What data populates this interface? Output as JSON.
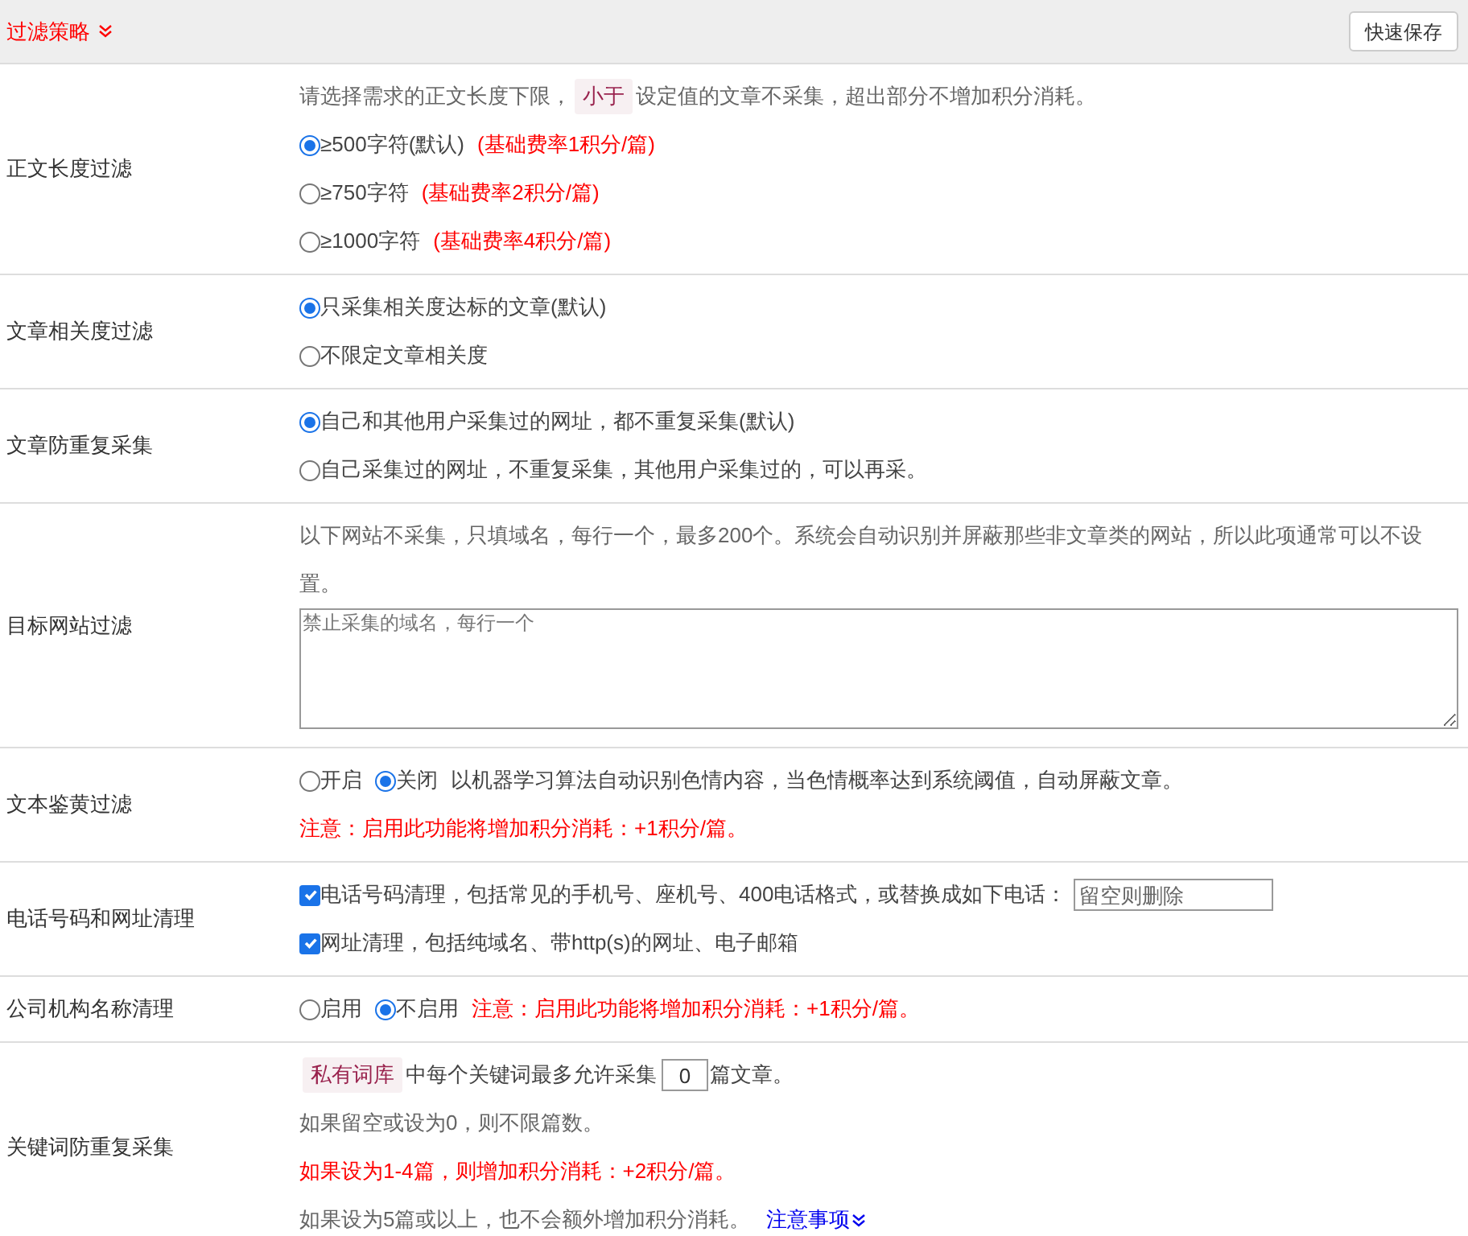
{
  "header": {
    "title": "过滤策略",
    "button": "快速保存"
  },
  "rows": [
    {
      "label": "正文长度过滤",
      "lines": [
        [
          {
            "kind": "text",
            "text": "请选择需求的正文长度下限，"
          },
          {
            "kind": "tag",
            "text": "小于"
          },
          {
            "kind": "text",
            "text": "设定值的文章不采集，超出部分不增加积分消耗。"
          }
        ],
        [
          {
            "kind": "radio",
            "text": "≥500字符(默认)",
            "selected": true
          },
          {
            "kind": "note",
            "text": "(基础费率1积分/篇)"
          }
        ],
        [
          {
            "kind": "radio",
            "text": "≥750字符",
            "selected": false
          },
          {
            "kind": "note",
            "text": "(基础费率2积分/篇)"
          }
        ],
        [
          {
            "kind": "radio",
            "text": "≥1000字符",
            "selected": false
          },
          {
            "kind": "note",
            "text": "(基础费率4积分/篇)"
          }
        ]
      ]
    },
    {
      "label": "文章相关度过滤",
      "lines": [
        [
          {
            "kind": "radio",
            "text": "只采集相关度达标的文章(默认)",
            "selected": true
          }
        ],
        [
          {
            "kind": "radio",
            "text": "不限定文章相关度",
            "selected": false
          }
        ]
      ]
    },
    {
      "label": "文章防重复采集",
      "lines": [
        [
          {
            "kind": "radio",
            "text": "自己和其他用户采集过的网址，都不重复采集(默认)",
            "selected": true
          }
        ],
        [
          {
            "kind": "radio",
            "text": "自己采集过的网址，不重复采集，其他用户采集过的，可以再采。",
            "selected": false
          }
        ]
      ]
    },
    {
      "label": "目标网站过滤",
      "lines": [
        [
          {
            "kind": "text",
            "text": "以下网站不采集，只填域名，每行一个，最多200个。系统会自动识别并屏蔽那些非文章类的网站，所以此项通常可以不设置。"
          }
        ],
        [
          {
            "kind": "textarea",
            "placeholder": "禁止采集的域名，每行一个"
          }
        ]
      ]
    },
    {
      "label": "文本鉴黄过滤",
      "lines": [
        [
          {
            "kind": "radio",
            "text": "开启",
            "selected": false
          },
          {
            "kind": "radio",
            "text": "关闭",
            "selected": true
          },
          {
            "kind": "body",
            "text": "以机器学习算法自动识别色情内容，当色情概率达到系统阈值，自动屏蔽文章。"
          }
        ],
        [
          {
            "kind": "note",
            "text": "注意：启用此功能将增加积分消耗：+1积分/篇。"
          }
        ]
      ]
    },
    {
      "label": "电话号码和网址清理",
      "lines": [
        [
          {
            "kind": "checkbox",
            "text": "电话号码清理，包括常见的手机号、座机号、400电话格式，或替换成如下电话：",
            "checked": true
          },
          {
            "kind": "input",
            "placeholder": "留空则删除"
          }
        ],
        [
          {
            "kind": "checkbox",
            "text": "网址清理，包括纯域名、带http(s)的网址、电子邮箱",
            "checked": true
          }
        ]
      ]
    },
    {
      "label": "公司机构名称清理",
      "lines": [
        [
          {
            "kind": "radio",
            "text": "启用",
            "selected": false
          },
          {
            "kind": "radio",
            "text": "不启用",
            "selected": true
          },
          {
            "kind": "note",
            "text": "注意：启用此功能将增加积分消耗：+1积分/篇。"
          }
        ]
      ]
    },
    {
      "label": "关键词防重复采集",
      "lines": [
        [
          {
            "kind": "tag",
            "text": "私有词库"
          },
          {
            "kind": "body",
            "text": "中每个关键词最多允许采集"
          },
          {
            "kind": "number",
            "value": "0"
          },
          {
            "kind": "body",
            "text": "篇文章。"
          }
        ],
        [
          {
            "kind": "text",
            "text": "如果留空或设为0，则不限篇数。"
          }
        ],
        [
          {
            "kind": "note",
            "text": "如果设为1-4篇，则增加积分消耗：+2积分/篇。"
          }
        ],
        [
          {
            "kind": "text",
            "text": "如果设为5篇或以上，也不会额外增加积分消耗。"
          },
          {
            "kind": "link",
            "text": "注意事项"
          }
        ]
      ]
    }
  ]
}
